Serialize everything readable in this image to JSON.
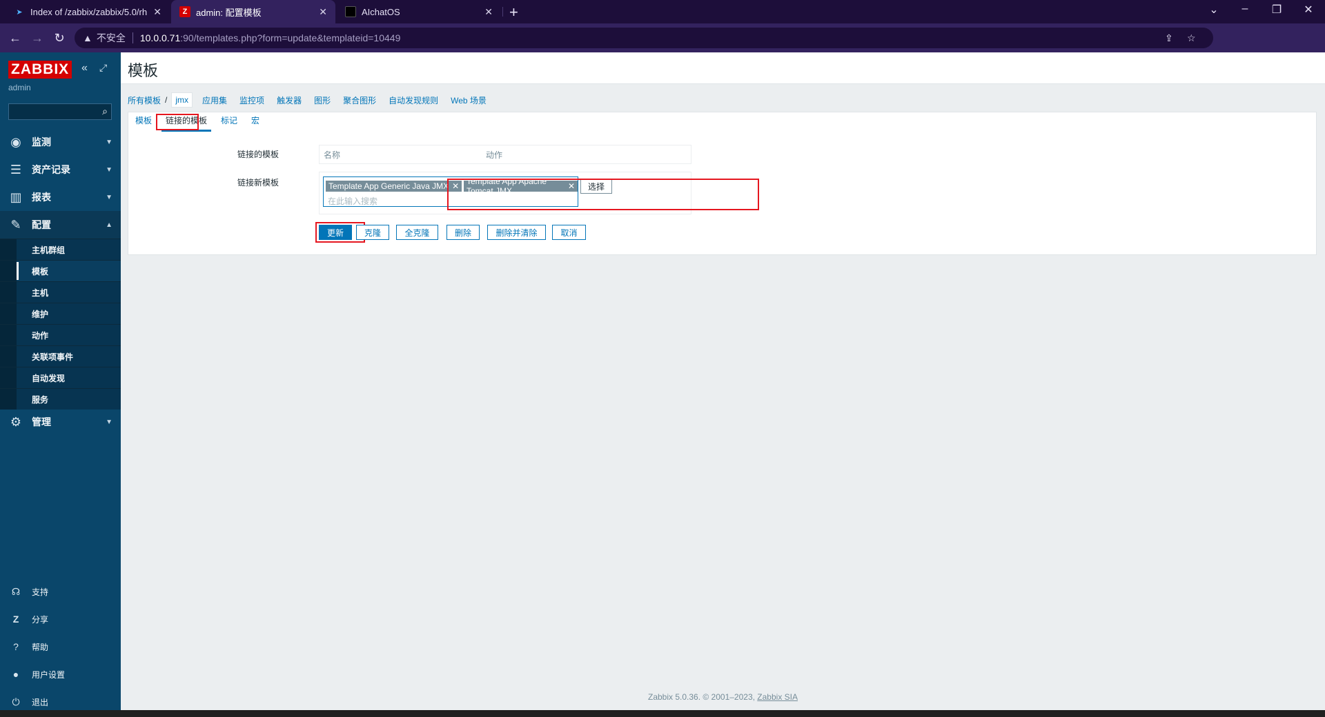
{
  "browser": {
    "tabs": [
      {
        "title": "Index of /zabbix/zabbix/5.0/rh"
      },
      {
        "title": "admin: 配置模板"
      },
      {
        "title": "AIchatOS"
      }
    ],
    "security_label": "不安全",
    "url_host": "10.0.0.71",
    "url_path": ":90/templates.php?form=update&templateid=10449"
  },
  "sidebar": {
    "logo": "ZABBIX",
    "user": "admin",
    "menu": [
      {
        "label": "监测",
        "icon": "eye-icon"
      },
      {
        "label": "资产记录",
        "icon": "list-icon"
      },
      {
        "label": "报表",
        "icon": "bar-chart-icon"
      },
      {
        "label": "配置",
        "icon": "wrench-icon"
      },
      {
        "label": "管理",
        "icon": "gear-icon"
      }
    ],
    "config_submenu": [
      "主机群组",
      "模板",
      "主机",
      "维护",
      "动作",
      "关联项事件",
      "自动发现",
      "服务"
    ],
    "bottom": [
      {
        "label": "支持",
        "icon": "headset-icon"
      },
      {
        "label": "分享",
        "icon": "share-icon"
      },
      {
        "label": "帮助",
        "icon": "help-icon"
      },
      {
        "label": "用户设置",
        "icon": "user-icon"
      },
      {
        "label": "退出",
        "icon": "power-icon"
      }
    ]
  },
  "main": {
    "title": "模板",
    "breadcrumb": {
      "all": "所有模板",
      "sep": "/",
      "current": "jmx",
      "links": [
        "应用集",
        "监控项",
        "触发器",
        "图形",
        "聚合图形",
        "自动发现规则",
        "Web 场景"
      ]
    },
    "tabs": [
      "模板",
      "链接的模板",
      "标记",
      "宏"
    ],
    "form": {
      "linked_label": "链接的模板",
      "col_name": "名称",
      "col_action": "动作",
      "new_label": "链接新模板",
      "chips": [
        "Template App Generic Java JMX",
        "Template App Apache Tomcat JMX"
      ],
      "placeholder": "在此输入搜索",
      "select_btn": "选择"
    },
    "buttons": {
      "update": "更新",
      "clone": "克隆",
      "full_clone": "全克隆",
      "delete": "删除",
      "delete_clear": "删除并清除",
      "cancel": "取消"
    },
    "footer": {
      "text": "Zabbix 5.0.36. © 2001–2023, ",
      "link": "Zabbix SIA"
    }
  },
  "colors": {
    "sidebar_bg": "#0a466a",
    "accent": "#0275b8",
    "highlight": "#e5161f",
    "logo_bg": "#d40000"
  }
}
